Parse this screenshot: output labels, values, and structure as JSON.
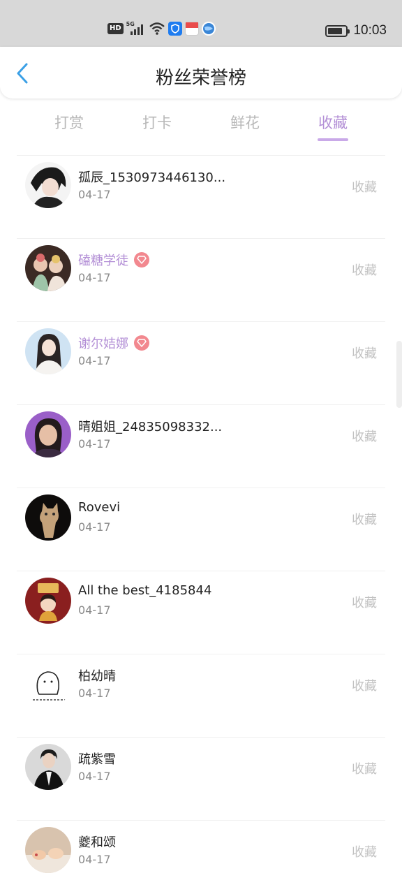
{
  "status_bar": {
    "hd": "HD",
    "network": "5G",
    "time": "10:03",
    "battery_level": 0.82,
    "icons": [
      "hd-icon",
      "signal-icon",
      "wifi-icon",
      "shield-app-icon",
      "mail-app-icon",
      "globe-app-icon",
      "battery-icon"
    ]
  },
  "header": {
    "back_icon": "chevron-left-icon",
    "title": "粉丝荣誉榜"
  },
  "tabs": [
    {
      "label": "打赏",
      "active": false
    },
    {
      "label": "打卡",
      "active": false
    },
    {
      "label": "鲜花",
      "active": false
    },
    {
      "label": "收藏",
      "active": true
    }
  ],
  "colors": {
    "accent": "#b38fd6",
    "vip_badge": "#f2888f",
    "inactive_tab": "#b8b8b8",
    "action_text": "#c2c2c2"
  },
  "list": [
    {
      "name": "孤辰_1530973446130...",
      "date": "04-17",
      "action": "收藏",
      "vip": false
    },
    {
      "name": "磕糖学徒",
      "date": "04-17",
      "action": "收藏",
      "vip": true
    },
    {
      "name": "谢尔姞娜",
      "date": "04-17",
      "action": "收藏",
      "vip": true
    },
    {
      "name": "晴姐姐_24835098332...",
      "date": "04-17",
      "action": "收藏",
      "vip": false
    },
    {
      "name": "Rovevi",
      "date": "04-17",
      "action": "收藏",
      "vip": false
    },
    {
      "name": "All the best_4185844",
      "date": "04-17",
      "action": "收藏",
      "vip": false
    },
    {
      "name": "柏幼晴",
      "date": "04-17",
      "action": "收藏",
      "vip": false
    },
    {
      "name": "疏紫雪",
      "date": "04-17",
      "action": "收藏",
      "vip": false
    },
    {
      "name": "夔和颂",
      "date": "04-17",
      "action": "收藏",
      "vip": false
    }
  ]
}
